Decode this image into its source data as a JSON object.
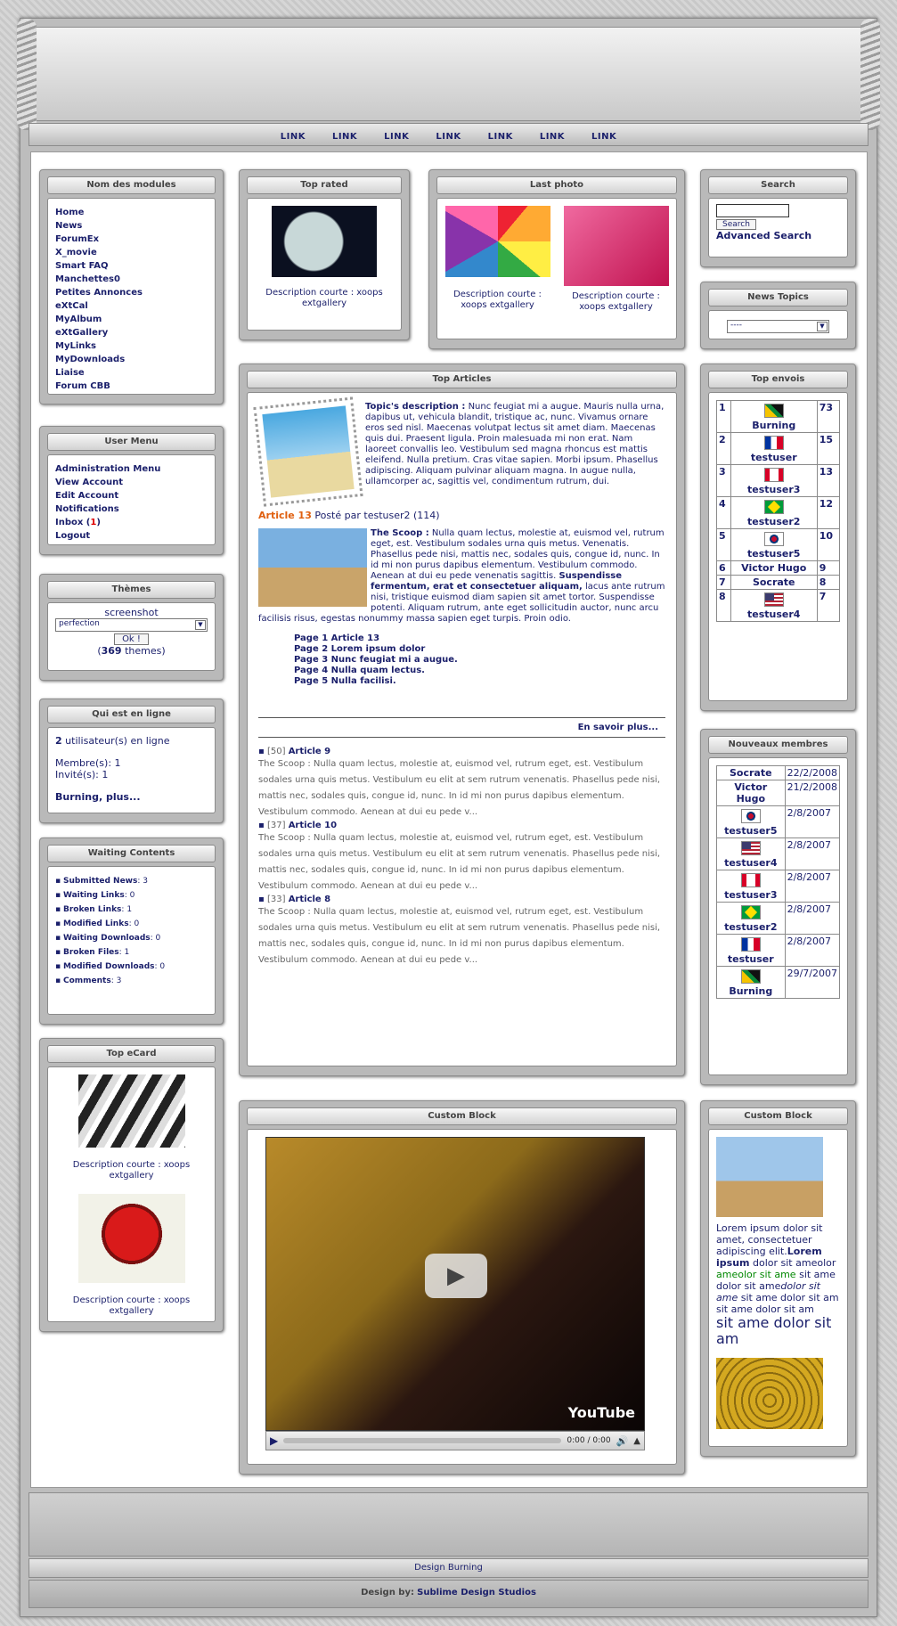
{
  "nav": [
    "LINK",
    "LINK",
    "LINK",
    "LINK",
    "LINK",
    "LINK",
    "LINK"
  ],
  "modules": {
    "title": "Nom des modules",
    "items": [
      "Home",
      "News",
      "ForumEx",
      "X_movie",
      "Smart FAQ",
      "Manchettes0",
      "Petites Annonces",
      "eXtCal",
      "MyAlbum",
      "eXtGallery",
      "MyLinks",
      "MyDownloads",
      "Liaise",
      "Forum CBB"
    ]
  },
  "user_menu": {
    "title": "User Menu",
    "items": [
      "Administration Menu",
      "View Account",
      "Edit Account",
      "Notifications"
    ],
    "inbox_label": "Inbox (",
    "inbox_count": "1",
    "inbox_close": ")",
    "logout": "Logout"
  },
  "themes": {
    "title": "Thèmes",
    "screenshot": "screenshot",
    "selected": "perfection",
    "ok": "Ok !",
    "count_open": "(",
    "count": "369",
    "count_suffix": " themes)"
  },
  "online": {
    "title": "Qui est en ligne",
    "count": "2",
    "count_suffix": " utilisateur(s) en ligne",
    "members": "Membre(s): 1",
    "guests": "Invité(s): 1",
    "more": "Burning, plus..."
  },
  "waiting": {
    "title": "Waiting Contents",
    "items": [
      {
        "label": "Submitted News",
        "count": ": 3"
      },
      {
        "label": "Waiting Links",
        "count": ": 0"
      },
      {
        "label": "Broken Links",
        "count": ": 1"
      },
      {
        "label": "Modified Links",
        "count": ": 0"
      },
      {
        "label": "Waiting Downloads",
        "count": ": 0"
      },
      {
        "label": "Broken Files",
        "count": ": 1"
      },
      {
        "label": "Modified Downloads",
        "count": ": 0"
      },
      {
        "label": "Comments",
        "count": ": 3"
      }
    ]
  },
  "ecard": {
    "title": "Top eCard",
    "desc1": "Description courte : xoops extgallery",
    "desc2": "Description courte : xoops extgallery"
  },
  "top_rated": {
    "title": "Top rated",
    "desc": "Description courte : xoops extgallery"
  },
  "last_photo": {
    "title": "Last photo",
    "desc1": "Description courte : xoops extgallery",
    "desc2": "Description courte : xoops extgallery"
  },
  "search": {
    "title": "Search",
    "button": "Search",
    "advanced": "Advanced Search"
  },
  "news_topics": {
    "title": "News Topics",
    "selected": "----"
  },
  "top_articles": {
    "title": "Top Articles",
    "topic_label": "Topic's description :",
    "topic_text": " Nunc feugiat mi a augue. Mauris nulla urna, dapibus ut, vehicula blandit, tristique ac, nunc. Vivamus ornare eros sed nisl. Maecenas volutpat lectus sit amet diam. Maecenas quis dui. Praesent ligula. Proin malesuada mi non erat. Nam laoreet convallis leo. Vestibulum sed magna rhoncus est mattis eleifend. Nulla pretium. Cras vitae sapien. Morbi ipsum. Phasellus adipiscing. Aliquam pulvinar aliquam magna. In augue nulla, ullamcorper ac, sagittis vel, condimentum rutrum, dui.",
    "article_title": "Article 13",
    "posted": " Posté par testuser2 (114)",
    "scoop_label": "The Scoop :",
    "scoop_text1": " Nulla quam lectus, molestie at, euismod vel, rutrum eget, est. Vestibulum sodales urna quis metus. Venenatis. Phasellus pede nisi, mattis nec, sodales quis, congue id, nunc. In id mi non purus dapibus elementum. Vestibulum commodo. Aenean at dui eu pede venenatis sagittis. ",
    "scoop_bold": "Suspendisse fermentum, erat et consectetuer aliquam,",
    "scoop_text2": " lacus ante rutrum nisi, tristique euismod diam sapien sit amet tortor. Suspendisse potenti. Aliquam rutrum, ante eget sollicitudin auctor, nunc arcu facilisis risus, egestas nonummy massa sapien eget turpis. Proin odio.",
    "pages": [
      "Page 1 Article 13",
      "Page 2 Lorem ipsum dolor",
      "Page 3 Nunc feugiat mi a augue.",
      "Page 4 Nulla quam lectus.",
      "Page 5 Nulla facilisi."
    ],
    "more": "En savoir plus...",
    "list": [
      {
        "num": "[50]",
        "title": "Article 9",
        "text": "The Scoop : Nulla quam lectus, molestie at, euismod vel, rutrum eget, est. Vestibulum sodales urna quis metus. Vestibulum eu elit at sem rutrum venenatis. Phasellus pede nisi, mattis nec, sodales quis, congue id, nunc. In id mi non purus dapibus elementum. Vestibulum commodo. Aenean at dui eu pede v..."
      },
      {
        "num": "[37]",
        "title": "Article 10",
        "text": "The Scoop : Nulla quam lectus, molestie at, euismod vel, rutrum eget, est. Vestibulum sodales urna quis metus. Vestibulum eu elit at sem rutrum venenatis. Phasellus pede nisi, mattis nec, sodales quis, congue id, nunc. In id mi non purus dapibus elementum. Vestibulum commodo. Aenean at dui eu pede v..."
      },
      {
        "num": "[33]",
        "title": "Article 8",
        "text": "The Scoop : Nulla quam lectus, molestie at, euismod vel, rutrum eget, est. Vestibulum sodales urna quis metus. Vestibulum eu elit at sem rutrum venenatis. Phasellus pede nisi, mattis nec, sodales quis, congue id, nunc. In id mi non purus dapibus elementum. Vestibulum commodo. Aenean at dui eu pede v..."
      }
    ]
  },
  "top_envois": {
    "title": "Top envois",
    "rows": [
      {
        "rank": "1",
        "name": "Burning",
        "count": "73",
        "flag": "jm"
      },
      {
        "rank": "2",
        "name": "testuser",
        "count": "15",
        "flag": "fr"
      },
      {
        "rank": "3",
        "name": "testuser3",
        "count": "13",
        "flag": "ca"
      },
      {
        "rank": "4",
        "name": "testuser2",
        "count": "12",
        "flag": "br"
      },
      {
        "rank": "5",
        "name": "testuser5",
        "count": "10",
        "flag": "kr"
      },
      {
        "rank": "6",
        "name": "Victor Hugo",
        "count": "9",
        "flag": ""
      },
      {
        "rank": "7",
        "name": "Socrate",
        "count": "8",
        "flag": ""
      },
      {
        "rank": "8",
        "name": "testuser4",
        "count": "7",
        "flag": "us"
      }
    ]
  },
  "new_members": {
    "title": "Nouveaux membres",
    "rows": [
      {
        "name": "Socrate",
        "date": "22/2/2008",
        "flag": ""
      },
      {
        "name": "Victor Hugo",
        "date": "21/2/2008",
        "flag": ""
      },
      {
        "name": "testuser5",
        "date": "2/8/2007",
        "flag": "kr"
      },
      {
        "name": "testuser4",
        "date": "2/8/2007",
        "flag": "us"
      },
      {
        "name": "testuser3",
        "date": "2/8/2007",
        "flag": "ca"
      },
      {
        "name": "testuser2",
        "date": "2/8/2007",
        "flag": "br"
      },
      {
        "name": "testuser",
        "date": "2/8/2007",
        "flag": "fr"
      },
      {
        "name": "Burning",
        "date": "29/7/2007",
        "flag": "jm"
      }
    ]
  },
  "custom_block": {
    "title": "Custom Block",
    "time": "0:00 / 0:00",
    "logo": "YouTube"
  },
  "custom_block2": {
    "title": "Custom Block",
    "t1": "Lorem ipsum dolor sit amet, consectetuer adipiscing elit.",
    "t2": "Lorem ipsum",
    "t3": " dolor sit ameolor ",
    "t4": "ameolor sit ame",
    "t5": " sit ame dolor sit ame",
    "t6": "dolor sit ame",
    "t7": " sit ame dolor sit am sit ame dolor sit am",
    "t8": "sit ame dolor sit am"
  },
  "footer": {
    "design": "Design Burning",
    "by_label": "Design by:",
    "by": "Sublime Design Studios"
  }
}
